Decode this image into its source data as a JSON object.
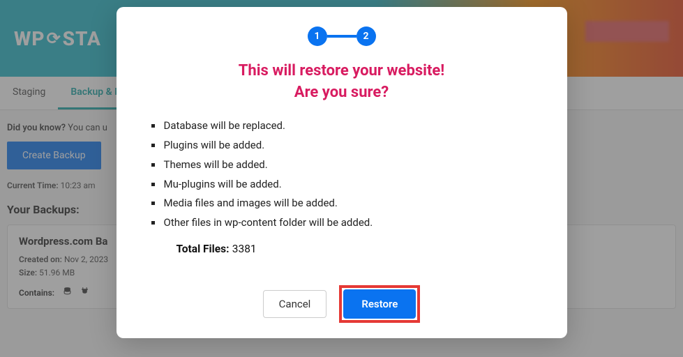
{
  "header": {
    "logo_prefix": "WP",
    "logo_suffix": "STA"
  },
  "tabs": {
    "staging": "Staging",
    "backup": "Backup & Mi"
  },
  "sidebar": {
    "hint_prefix": "Did you know?",
    "hint_rest": " You can u",
    "create_backup": "Create Backup",
    "current_time_label": "Current Time:",
    "current_time_value": "10:23 am",
    "your_backups": "Your Backups:"
  },
  "backup_card": {
    "title": "Wordpress.com Ba",
    "created_label": "Created on:",
    "created_value": "Nov 2, 2023",
    "size_label": "Size:",
    "size_value": "51.96 MB",
    "contains_label": "Contains:"
  },
  "modal": {
    "step1": "1",
    "step2": "2",
    "title_line1": "This will restore your website!",
    "title_line2": "Are you sure?",
    "items": [
      "Database will be replaced.",
      "Plugins will be added.",
      "Themes will be added.",
      "Mu-plugins will be added.",
      "Media files and images will be added.",
      "Other files in wp-content folder will be added."
    ],
    "total_label": "Total Files:",
    "total_value": "3381",
    "cancel": "Cancel",
    "restore": "Restore"
  }
}
